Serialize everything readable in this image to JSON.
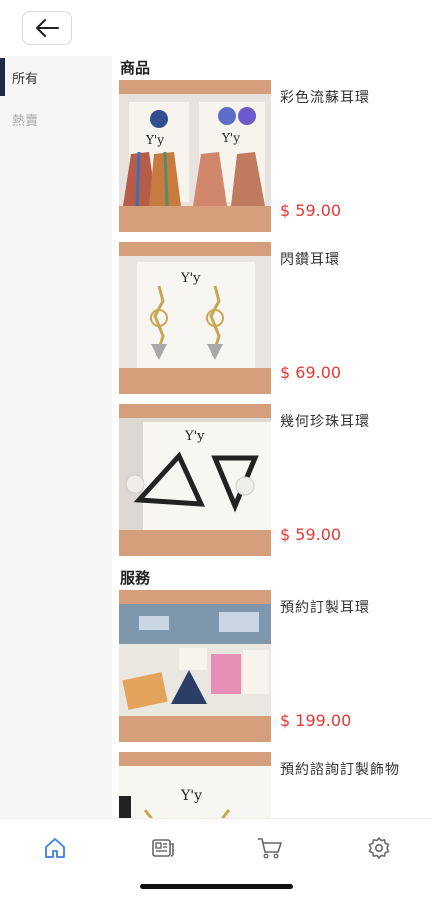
{
  "header": {
    "back_icon": "arrow-left-icon"
  },
  "sidebar": {
    "items": [
      {
        "label": "所有"
      },
      {
        "label": "熱賣"
      }
    ]
  },
  "main": {
    "sections": [
      {
        "title": "商品",
        "items": [
          {
            "name": "彩色流蘇耳環",
            "price": "$ 59.00"
          },
          {
            "name": "閃鑽耳環",
            "price": "$ 69.00"
          },
          {
            "name": "幾何珍珠耳環",
            "price": "$ 59.00"
          }
        ]
      },
      {
        "title": "服務",
        "items": [
          {
            "name": "預約訂製耳環",
            "price": "$ 199.00"
          },
          {
            "name": "預約諮詢訂製飾物",
            "price": ""
          }
        ]
      }
    ]
  },
  "tabbar": {
    "items": [
      "home-icon",
      "news-icon",
      "cart-icon",
      "settings-icon"
    ]
  },
  "colors": {
    "price": "#e53935",
    "accent": "#3b7de9",
    "thumb_bg": "#d49f7a"
  }
}
